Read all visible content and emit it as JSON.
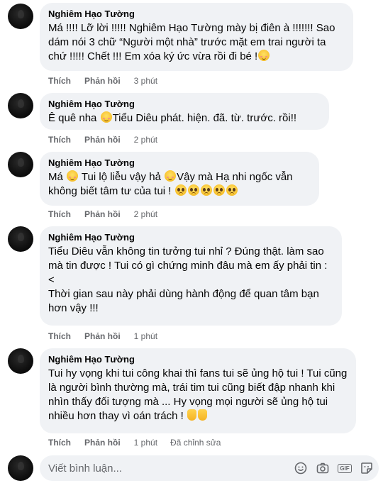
{
  "comments": [
    {
      "author": "Nghiêm Hạo Tường",
      "text": "Má !!!! Lỡ lời !!!!! Nghiêm Hạo Tường mày bị điên à !!!!!!! Sao dám nói 3 chữ “Người một nhà” trước mặt em trai người ta chứ !!!!! Chết !!! Em xóa ký ức vừa rồi đi bé !",
      "like": "Thích",
      "reply": "Phản hồi",
      "time": "3 phút"
    },
    {
      "author": "Nghiêm Hạo Tường",
      "text_before": "Ê quê nha ",
      "text_after": "Tiểu Diêu phát. hiện. đã. từ. trước. rồi!!",
      "like": "Thích",
      "reply": "Phản hồi",
      "time": "2 phút"
    },
    {
      "author": "Nghiêm Hạo Tường",
      "text_part1": "Má ",
      "text_part2": " Tui lộ liễu vậy hả ",
      "text_part3": "Vậy mà Hạ nhi ngốc vẫn không biết tâm tư của tui ! ",
      "like": "Thích",
      "reply": "Phản hồi",
      "time": "2 phút"
    },
    {
      "author": "Nghiêm Hạo Tường",
      "text": "Tiểu Diêu vẫn không tin tưởng tui nhỉ ? Đúng thật. làm sao mà tin được ! Tui có gì chứng minh đâu mà em ấy phải tin :<\nThời gian sau này phải dùng hành động để quan tâm bạn hơn vậy !!!",
      "like": "Thích",
      "reply": "Phản hồi",
      "time": "1 phút"
    },
    {
      "author": "Nghiêm Hạo Tường",
      "text": "Tui hy vọng khi tui công khai thì fans tui sẽ ủng hộ tui ! Tui cũng là người bình thường mà, trái tim tui cũng biết đập nhanh khi nhìn thấy đối tượng mà ... Hy vọng mọi người sẽ ủng hộ tui nhiều hơn thay vì oán trách ! ",
      "like": "Thích",
      "reply": "Phản hồi",
      "time": "1 phút",
      "edited": "Đã chỉnh sửa"
    }
  ],
  "composer": {
    "placeholder": "Viết bình luận...",
    "gif_label": "GIF"
  },
  "icons": [
    "smiley-icon",
    "camera-icon",
    "gif-icon",
    "sticker-icon"
  ],
  "colors": {
    "bubble": "#f0f2f5",
    "meta": "#65676b",
    "text": "#050505"
  }
}
